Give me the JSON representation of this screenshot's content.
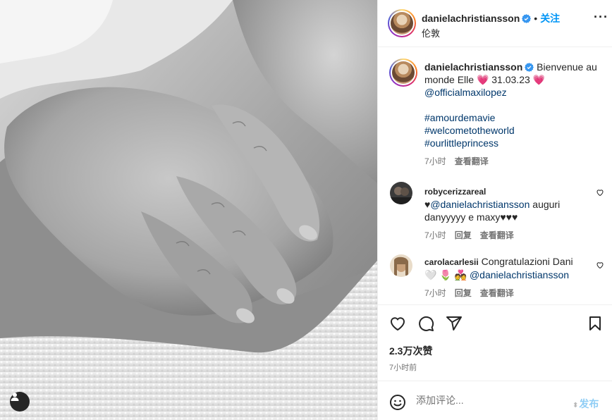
{
  "media": {
    "alt_icon": "user-tag-icon"
  },
  "header": {
    "username": "danielachristiansson",
    "separator": "•",
    "follow_label": "关注",
    "location": "伦敦",
    "more_icon": "more-icon",
    "more_label": "···"
  },
  "caption": {
    "username": "danielachristiansson",
    "text_part1": "Bienvenue au monde Elle",
    "heart_emoji": "💗",
    "date": "31.03.23",
    "mention": "@officialmaxilopez",
    "hashtags": [
      "#amourdemavie",
      "#welcometotheworld",
      "#ourlittleprincess"
    ],
    "time": "7小时",
    "translate": "查看翻译"
  },
  "comments": [
    {
      "username": "robycerizzareal",
      "prefix": "♥",
      "mention": "@danielachristiansson",
      "text": " auguri danyyyyy e maxy♥♥♥",
      "time": "7小时",
      "reply": "回复",
      "translate": "查看翻译"
    },
    {
      "username": "carolacarlesii",
      "text": " Congratulazioni Dani ",
      "emojis": "🤍 🌷 💑",
      "mention": "@danielachristiansson",
      "time": "7小时",
      "reply": "回复",
      "translate": "查看翻译"
    }
  ],
  "actions": {
    "icons": [
      "heart-icon",
      "comment-icon",
      "share-icon",
      "bookmark-icon"
    ],
    "likes": "2.3万次赞",
    "time": "7小时前"
  },
  "add_comment": {
    "placeholder": "添加评论...",
    "post_label": "发布"
  },
  "colors": {
    "accent": "#0095f6",
    "link": "#00376b",
    "muted": "#737373",
    "verified": "#3897f0"
  }
}
